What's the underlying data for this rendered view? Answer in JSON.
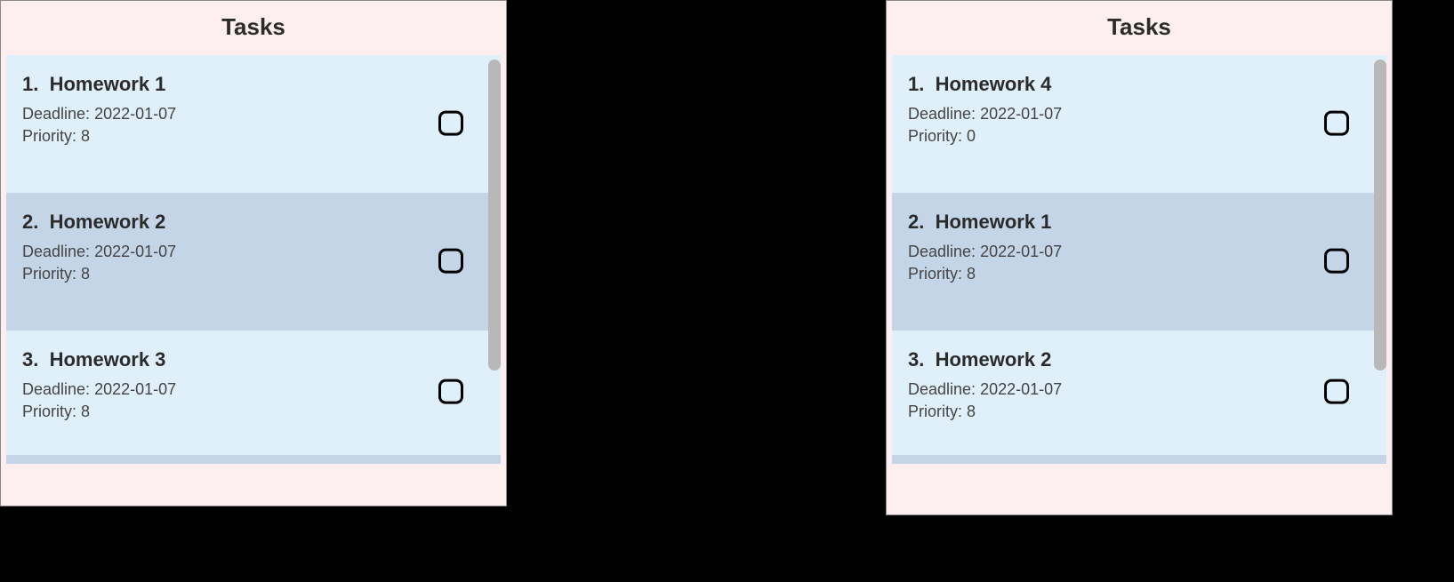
{
  "panels": [
    {
      "title": "Tasks",
      "items": [
        {
          "index": "1.",
          "name": "Homework 1",
          "deadline_label": "Deadline:",
          "deadline": "2022-01-07",
          "priority_label": "Priority:",
          "priority": "8",
          "checked": false
        },
        {
          "index": "2.",
          "name": "Homework 2",
          "deadline_label": "Deadline:",
          "deadline": "2022-01-07",
          "priority_label": "Priority:",
          "priority": "8",
          "checked": false
        },
        {
          "index": "3.",
          "name": "Homework 3",
          "deadline_label": "Deadline:",
          "deadline": "2022-01-07",
          "priority_label": "Priority:",
          "priority": "8",
          "checked": false
        }
      ]
    },
    {
      "title": "Tasks",
      "items": [
        {
          "index": "1.",
          "name": "Homework 4",
          "deadline_label": "Deadline:",
          "deadline": "2022-01-07",
          "priority_label": "Priority:",
          "priority": "0",
          "checked": false
        },
        {
          "index": "2.",
          "name": "Homework 1",
          "deadline_label": "Deadline:",
          "deadline": "2022-01-07",
          "priority_label": "Priority:",
          "priority": "8",
          "checked": false
        },
        {
          "index": "3.",
          "name": "Homework 2",
          "deadline_label": "Deadline:",
          "deadline": "2022-01-07",
          "priority_label": "Priority:",
          "priority": "8",
          "checked": false
        }
      ]
    }
  ]
}
